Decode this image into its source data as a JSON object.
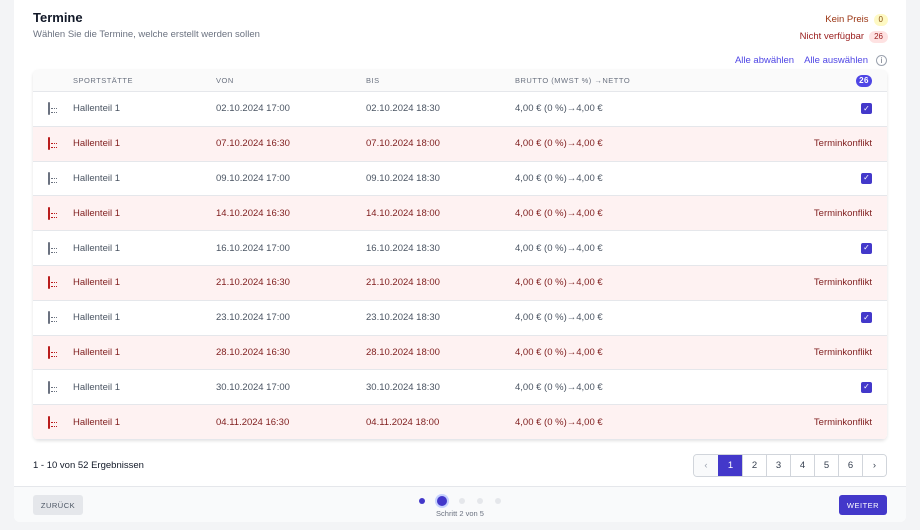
{
  "header": {
    "title": "Termine",
    "subtitle": "Wählen Sie die Termine, welche erstellt werden sollen"
  },
  "legend": {
    "no_price_label": "Kein Preis",
    "no_price_count": "0",
    "unavailable_label": "Nicht verfügbar",
    "unavailable_count": "26"
  },
  "actions": {
    "deselect_all": "Alle abwählen",
    "select_all": "Alle auswählen",
    "info_glyph": "i"
  },
  "table": {
    "columns": {
      "place": "SPORTSTÄTTE",
      "from": "VON",
      "to": "BIS",
      "price": "BRUTTO (MWST %) →NETTO",
      "selected_count": "26"
    },
    "rows": [
      {
        "place": "Hallenteil 1",
        "from": "02.10.2024 17:00",
        "to": "02.10.2024 18:30",
        "price": "4,00 € (0 %)→4,00 €",
        "status": "selected",
        "status_text": ""
      },
      {
        "place": "Hallenteil 1",
        "from": "07.10.2024 16:30",
        "to": "07.10.2024 18:00",
        "price": "4,00 € (0 %)→4,00 €",
        "status": "conflict",
        "status_text": "Terminkonflikt"
      },
      {
        "place": "Hallenteil 1",
        "from": "09.10.2024 17:00",
        "to": "09.10.2024 18:30",
        "price": "4,00 € (0 %)→4,00 €",
        "status": "selected",
        "status_text": ""
      },
      {
        "place": "Hallenteil 1",
        "from": "14.10.2024 16:30",
        "to": "14.10.2024 18:00",
        "price": "4,00 € (0 %)→4,00 €",
        "status": "conflict",
        "status_text": "Terminkonflikt"
      },
      {
        "place": "Hallenteil 1",
        "from": "16.10.2024 17:00",
        "to": "16.10.2024 18:30",
        "price": "4,00 € (0 %)→4,00 €",
        "status": "selected",
        "status_text": ""
      },
      {
        "place": "Hallenteil 1",
        "from": "21.10.2024 16:30",
        "to": "21.10.2024 18:00",
        "price": "4,00 € (0 %)→4,00 €",
        "status": "conflict",
        "status_text": "Terminkonflikt"
      },
      {
        "place": "Hallenteil 1",
        "from": "23.10.2024 17:00",
        "to": "23.10.2024 18:30",
        "price": "4,00 € (0 %)→4,00 €",
        "status": "selected",
        "status_text": ""
      },
      {
        "place": "Hallenteil 1",
        "from": "28.10.2024 16:30",
        "to": "28.10.2024 18:00",
        "price": "4,00 € (0 %)→4,00 €",
        "status": "conflict",
        "status_text": "Terminkonflikt"
      },
      {
        "place": "Hallenteil 1",
        "from": "30.10.2024 17:00",
        "to": "30.10.2024 18:30",
        "price": "4,00 € (0 %)→4,00 €",
        "status": "selected",
        "status_text": ""
      },
      {
        "place": "Hallenteil 1",
        "from": "04.11.2024 16:30",
        "to": "04.11.2024 18:00",
        "price": "4,00 € (0 %)→4,00 €",
        "status": "conflict",
        "status_text": "Terminkonflikt"
      }
    ]
  },
  "footer": {
    "results_text": "1 - 10 von 52 Ergebnissen"
  },
  "pagination": {
    "prev_glyph": "‹",
    "pages": [
      "1",
      "2",
      "3",
      "4",
      "5",
      "6"
    ],
    "active_page": "1",
    "next_glyph": "›"
  },
  "wizard": {
    "back_label": "ZURÜCK",
    "next_label": "WEITER",
    "step_text": "Schritt 2 von 5",
    "current_step": 2,
    "total_steps": 5
  },
  "colors": {
    "accent": "#4338ca",
    "conflict_bg": "#fef2f2",
    "conflict_text": "#7f1d1d"
  }
}
